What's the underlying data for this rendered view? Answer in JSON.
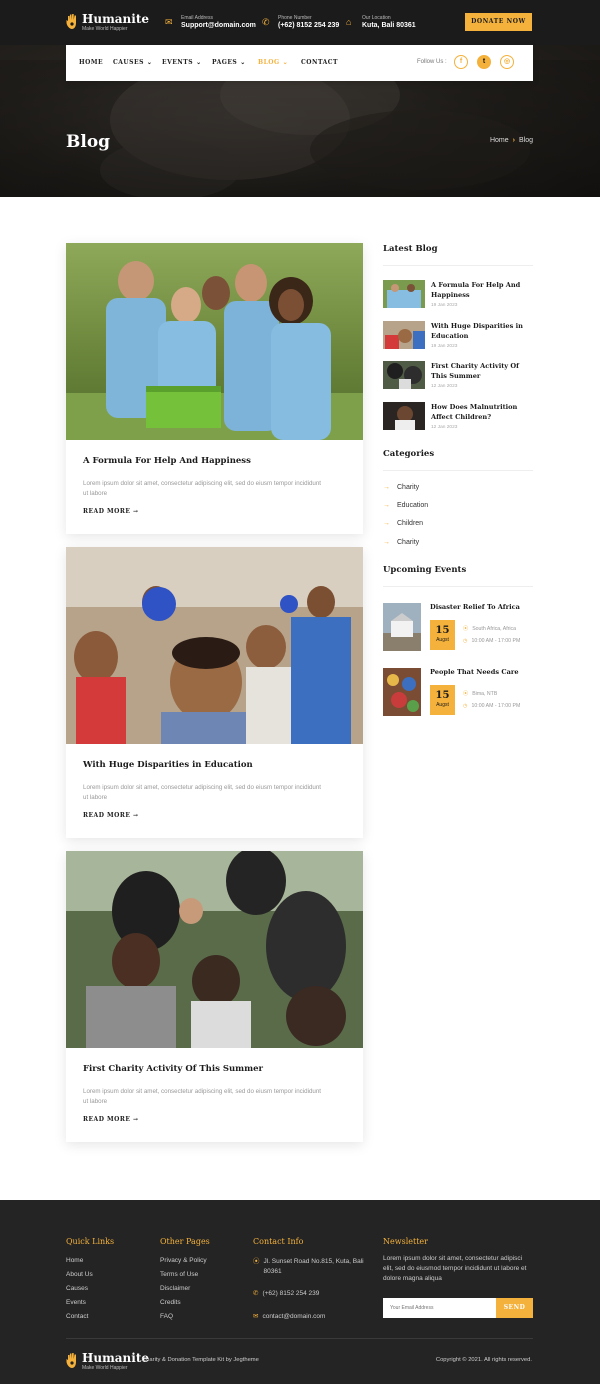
{
  "brand": {
    "name": "Humanite",
    "tagline": "Make World Happier"
  },
  "topbar": {
    "email": {
      "label": "Email Address",
      "value": "Support@domain.com"
    },
    "phone": {
      "label": "Phone Number",
      "value": "(+62) 8152 254 239"
    },
    "location": {
      "label": "Our Location",
      "value": "Kuta, Bali 80361"
    },
    "donate_label": "DONATE NOW"
  },
  "nav": {
    "items": [
      {
        "label": "HOME"
      },
      {
        "label": "CAUSES"
      },
      {
        "label": "EVENTS"
      },
      {
        "label": "PAGES"
      },
      {
        "label": "BLOG"
      },
      {
        "label": "CONTACT"
      }
    ],
    "active": "BLOG",
    "follow_label": "Follow Us :",
    "social": [
      "f",
      "t",
      "o"
    ]
  },
  "hero": {
    "title": "Blog",
    "breadcrumb": [
      "Home",
      "Blog"
    ]
  },
  "posts": [
    {
      "title": "A Formula For Help And Happiness",
      "excerpt": "Lorem ipsum dolor sit amet, consectetur adipiscing elit, sed do eiusm tempor incididunt ut labore",
      "more": "READ MORE"
    },
    {
      "title": "With Huge Disparities in Education",
      "excerpt": "Lorem ipsum dolor sit amet, consectetur adipiscing elit, sed do eiusm tempor incididunt ut labore",
      "more": "READ MORE"
    },
    {
      "title": "First Charity Activity Of This Summer",
      "excerpt": "Lorem ipsum dolor sit amet, consectetur adipiscing elit, sed do eiusm tempor incididunt ut labore",
      "more": "READ MORE"
    }
  ],
  "sidebar": {
    "latest_title": "Latest Blog",
    "latest": [
      {
        "title": "A Formula For Help And Happiness",
        "date": "19 Jan 2023"
      },
      {
        "title": "With Huge Disparities in Education",
        "date": "19 Jan 2023"
      },
      {
        "title": "First Charity Activity Of This Summer",
        "date": "12 Jan 2023"
      },
      {
        "title": "How Does Malnutrition Affect Children?",
        "date": "12 Jan 2023"
      }
    ],
    "categories_title": "Categories",
    "categories": [
      "Charity",
      "Education",
      "Children",
      "Charity"
    ],
    "events_title": "Upcoming Events",
    "events": [
      {
        "title": "Disaster Relief To Africa",
        "day": "15",
        "month": "Augst",
        "location": "South Africa, Africa",
        "time": "10:00 AM - 17:00 PM"
      },
      {
        "title": "People That Needs Care",
        "day": "15",
        "month": "Augst",
        "location": "Bima, NTB",
        "time": "10:00 AM - 17:00 PM"
      }
    ]
  },
  "footer": {
    "quick_title": "Quick Links",
    "quick": [
      "Home",
      "About Us",
      "Causes",
      "Events",
      "Contact"
    ],
    "other_title": "Other Pages",
    "other": [
      "Privacy & Policy",
      "Terms of Use",
      "Disclaimer",
      "Credits",
      "FAQ"
    ],
    "contact_title": "Contact Info",
    "address": "Jl. Sunset Road No.815, Kuta, Bali 80361",
    "phone": "(+62) 8152 254 239",
    "email": "contact@domain.com",
    "news_title": "Newsletter",
    "news_desc": "Lorem ipsum dolor sit amet, consectetur adipisci elit, sed do eiusmod tempor incididunt ut labore et dolore magna aliqua",
    "email_placeholder": "Your Email Address",
    "send_label": "SEND",
    "credit": "Charity & Donation Template Kit by Jegtheme",
    "copyright": "Copyright © 2021. All rights reserved."
  },
  "colors": {
    "accent": "#f4b13b",
    "dark": "#1b1b1b",
    "footer": "#242424"
  }
}
